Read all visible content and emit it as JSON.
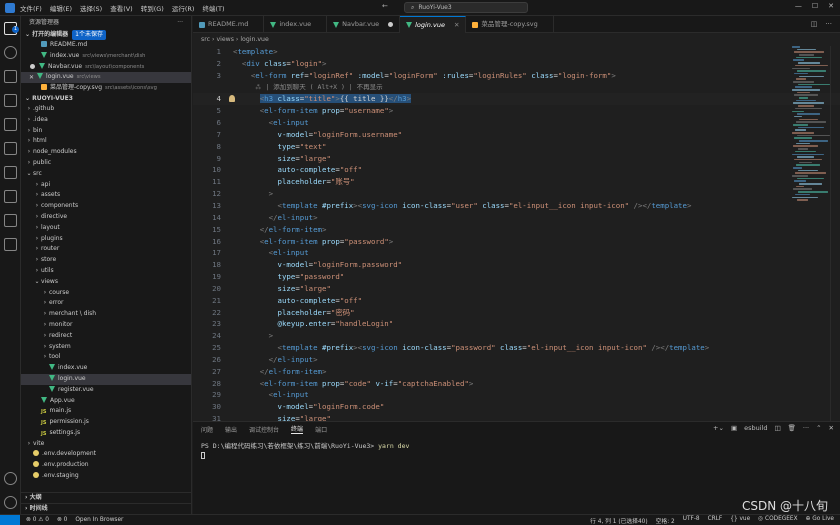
{
  "titlebar": {
    "menu": [
      "文件(F)",
      "编辑(E)",
      "选择(S)",
      "查看(V)",
      "转到(G)",
      "运行(R)",
      "终端(T)"
    ],
    "search": "RuoYi-Vue3",
    "nav_back": "←",
    "nav_forward": "→"
  },
  "sidebar": {
    "title": "资源管理器",
    "open_editors": {
      "label": "打开的编辑器",
      "badge": "1个未保存"
    },
    "open_files": [
      {
        "name": "README.md",
        "path": "",
        "icon": "md"
      },
      {
        "name": "index.vue",
        "path": "src\\views\\merchant\\dish",
        "icon": "vue"
      },
      {
        "name": "Navbar.vue",
        "path": "src\\layout\\components",
        "icon": "vue",
        "modified": true
      },
      {
        "name": "login.vue",
        "path": "src\\views",
        "icon": "vue",
        "active": true
      },
      {
        "name": "菜品管理-copy.svg",
        "path": "src\\assets\\icons\\svg",
        "icon": "svg"
      }
    ],
    "project": "RUOYI-VUE3",
    "tree": [
      {
        "name": ".github",
        "depth": 1,
        "chev": "›"
      },
      {
        "name": ".idea",
        "depth": 1,
        "chev": "›"
      },
      {
        "name": "bin",
        "depth": 1,
        "chev": "›"
      },
      {
        "name": "html",
        "depth": 1,
        "chev": "›"
      },
      {
        "name": "node_modules",
        "depth": 1,
        "chev": "›"
      },
      {
        "name": "public",
        "depth": 1,
        "chev": "›"
      },
      {
        "name": "src",
        "depth": 1,
        "chev": "⌄"
      },
      {
        "name": "api",
        "depth": 2,
        "chev": "›"
      },
      {
        "name": "assets",
        "depth": 2,
        "chev": "›"
      },
      {
        "name": "components",
        "depth": 2,
        "chev": "›"
      },
      {
        "name": "directive",
        "depth": 2,
        "chev": "›"
      },
      {
        "name": "layout",
        "depth": 2,
        "chev": "›"
      },
      {
        "name": "plugins",
        "depth": 2,
        "chev": "›"
      },
      {
        "name": "router",
        "depth": 2,
        "chev": "›"
      },
      {
        "name": "store",
        "depth": 2,
        "chev": "›"
      },
      {
        "name": "utils",
        "depth": 2,
        "chev": "›"
      },
      {
        "name": "views",
        "depth": 2,
        "chev": "⌄"
      },
      {
        "name": "course",
        "depth": 3,
        "chev": "›"
      },
      {
        "name": "error",
        "depth": 3,
        "chev": "›"
      },
      {
        "name": "merchant \\ dish",
        "depth": 3,
        "chev": "›"
      },
      {
        "name": "monitor",
        "depth": 3,
        "chev": "›"
      },
      {
        "name": "redirect",
        "depth": 3,
        "chev": "›"
      },
      {
        "name": "system",
        "depth": 3,
        "chev": "›"
      },
      {
        "name": "tool",
        "depth": 3,
        "chev": "›"
      },
      {
        "name": "index.vue",
        "depth": 3,
        "icon": "vue"
      },
      {
        "name": "login.vue",
        "depth": 3,
        "icon": "vue",
        "selected": true
      },
      {
        "name": "register.vue",
        "depth": 3,
        "icon": "vue"
      },
      {
        "name": "App.vue",
        "depth": 2,
        "icon": "vue"
      },
      {
        "name": "main.js",
        "depth": 2,
        "icon": "js"
      },
      {
        "name": "permission.js",
        "depth": 2,
        "icon": "js"
      },
      {
        "name": "settings.js",
        "depth": 2,
        "icon": "js"
      },
      {
        "name": "vite",
        "depth": 1,
        "chev": "›"
      },
      {
        "name": ".env.development",
        "depth": 1,
        "icon": "env"
      },
      {
        "name": ".env.production",
        "depth": 1,
        "icon": "env"
      },
      {
        "name": ".env.staging",
        "depth": 1,
        "icon": "env"
      }
    ],
    "outline": "大纲",
    "timeline": "时间线"
  },
  "tabs": [
    {
      "label": "README.md",
      "icon": "md"
    },
    {
      "label": "index.vue",
      "icon": "vue"
    },
    {
      "label": "Navbar.vue",
      "icon": "vue",
      "modified": true
    },
    {
      "label": "login.vue",
      "icon": "vue",
      "active": true
    },
    {
      "label": "菜品管理-copy.svg",
      "icon": "svg"
    }
  ],
  "breadcrumb": "src  ›  views  ›  login.vue",
  "editor": {
    "hint_text": "⁂ | 添加到聊天 ( Alt+X ) | 不再显示",
    "current_line": 4,
    "lines": [
      {
        "n": 1,
        "html": "<span class='p'>&lt;</span><span class='t'>template</span><span class='p'>&gt;</span>"
      },
      {
        "n": 2,
        "html": "  <span class='p'>&lt;</span><span class='t'>div</span> <span class='a'>class</span><span class='w'>=</span><span class='s'>\"login\"</span><span class='p'>&gt;</span>"
      },
      {
        "n": 3,
        "html": "    <span class='p'>&lt;</span><span class='t'>el-form</span> <span class='a'>ref</span><span class='w'>=</span><span class='s'>\"loginRef\"</span> <span class='a'>:model</span><span class='w'>=</span><span class='s'>\"loginForm\"</span> <span class='a'>:rules</span><span class='w'>=</span><span class='s'>\"loginRules\"</span> <span class='a'>class</span><span class='w'>=</span><span class='s'>\"login-form\"</span><span class='p'>&gt;</span>"
      },
      {
        "n": 4,
        "html": "      <span class='sel-txt'><span class='p'>&lt;</span><span class='t'>h3</span> <span class='a'>class</span><span class='w'>=</span><span class='s'>\"title\"</span><span class='p'>&gt;</span><span class='w'>{{ title }}</span><span class='p'>&lt;/</span><span class='t'>h3</span><span class='p'>&gt;</span></span>"
      },
      {
        "n": 5,
        "html": "      <span class='p'>&lt;</span><span class='t'>el-form-item</span> <span class='a'>prop</span><span class='w'>=</span><span class='s'>\"username\"</span><span class='p'>&gt;</span>"
      },
      {
        "n": 6,
        "html": "        <span class='p'>&lt;</span><span class='t'>el-input</span>"
      },
      {
        "n": 7,
        "html": "          <span class='a'>v-model</span><span class='w'>=</span><span class='s'>\"loginForm.username\"</span>"
      },
      {
        "n": 8,
        "html": "          <span class='a'>type</span><span class='w'>=</span><span class='s'>\"text\"</span>"
      },
      {
        "n": 9,
        "html": "          <span class='a'>size</span><span class='w'>=</span><span class='s'>\"large\"</span>"
      },
      {
        "n": 10,
        "html": "          <span class='a'>auto-complete</span><span class='w'>=</span><span class='s'>\"off\"</span>"
      },
      {
        "n": 11,
        "html": "          <span class='a'>placeholder</span><span class='w'>=</span><span class='s'>\"账号\"</span>"
      },
      {
        "n": 12,
        "html": "        <span class='p'>&gt;</span>"
      },
      {
        "n": 13,
        "html": "          <span class='p'>&lt;</span><span class='t'>template</span> <span class='a'>#prefix</span><span class='p'>&gt;&lt;</span><span class='t'>svg-icon</span> <span class='a'>icon-class</span><span class='w'>=</span><span class='s'>\"user\"</span> <span class='a'>class</span><span class='w'>=</span><span class='s'>\"el-input__icon input-icon\"</span> <span class='p'>/&gt;&lt;/</span><span class='t'>template</span><span class='p'>&gt;</span>"
      },
      {
        "n": 14,
        "html": "        <span class='p'>&lt;/</span><span class='t'>el-input</span><span class='p'>&gt;</span>"
      },
      {
        "n": 15,
        "html": "      <span class='p'>&lt;/</span><span class='t'>el-form-item</span><span class='p'>&gt;</span>"
      },
      {
        "n": 16,
        "html": "      <span class='p'>&lt;</span><span class='t'>el-form-item</span> <span class='a'>prop</span><span class='w'>=</span><span class='s'>\"password\"</span><span class='p'>&gt;</span>"
      },
      {
        "n": 17,
        "html": "        <span class='p'>&lt;</span><span class='t'>el-input</span>"
      },
      {
        "n": 18,
        "html": "          <span class='a'>v-model</span><span class='w'>=</span><span class='s'>\"loginForm.password\"</span>"
      },
      {
        "n": 19,
        "html": "          <span class='a'>type</span><span class='w'>=</span><span class='s'>\"password\"</span>"
      },
      {
        "n": 20,
        "html": "          <span class='a'>size</span><span class='w'>=</span><span class='s'>\"large\"</span>"
      },
      {
        "n": 21,
        "html": "          <span class='a'>auto-complete</span><span class='w'>=</span><span class='s'>\"off\"</span>"
      },
      {
        "n": 22,
        "html": "          <span class='a'>placeholder</span><span class='w'>=</span><span class='s'>\"密码\"</span>"
      },
      {
        "n": 23,
        "html": "          <span class='a'>@keyup.enter</span><span class='w'>=</span><span class='s'>\"handleLogin\"</span>"
      },
      {
        "n": 24,
        "html": "        <span class='p'>&gt;</span>"
      },
      {
        "n": 25,
        "html": "          <span class='p'>&lt;</span><span class='t'>template</span> <span class='a'>#prefix</span><span class='p'>&gt;&lt;</span><span class='t'>svg-icon</span> <span class='a'>icon-class</span><span class='w'>=</span><span class='s'>\"password\"</span> <span class='a'>class</span><span class='w'>=</span><span class='s'>\"el-input__icon input-icon\"</span> <span class='p'>/&gt;&lt;/</span><span class='t'>template</span><span class='p'>&gt;</span>"
      },
      {
        "n": 26,
        "html": "        <span class='p'>&lt;/</span><span class='t'>el-input</span><span class='p'>&gt;</span>"
      },
      {
        "n": 27,
        "html": "      <span class='p'>&lt;/</span><span class='t'>el-form-item</span><span class='p'>&gt;</span>"
      },
      {
        "n": 28,
        "html": "      <span class='p'>&lt;</span><span class='t'>el-form-item</span> <span class='a'>prop</span><span class='w'>=</span><span class='s'>\"code\"</span> <span class='a'>v-if</span><span class='w'>=</span><span class='s'>\"captchaEnabled\"</span><span class='p'>&gt;</span>"
      },
      {
        "n": 29,
        "html": "        <span class='p'>&lt;</span><span class='t'>el-input</span>"
      },
      {
        "n": 30,
        "html": "          <span class='a'>v-model</span><span class='w'>=</span><span class='s'>\"loginForm.code\"</span>"
      },
      {
        "n": 31,
        "html": "          <span class='a'>size</span><span class='w'>=</span><span class='s'>\"large\"</span>"
      }
    ]
  },
  "panel": {
    "tabs": [
      "问题",
      "输出",
      "调试控制台",
      "终端",
      "端口"
    ],
    "active_tab": "终端",
    "terminal_name": "esbuild",
    "prompt": "PS D:\\编程代码练习\\若依框架\\练习\\前端\\RuoYi-Vue3> ",
    "command": "yarn dev"
  },
  "status": {
    "left": [
      "⊗ 0 ⚠ 0",
      "⊗ 0",
      "Open In Browser"
    ],
    "right": [
      "行 4, 列 1 (已选择40)",
      "空格: 2",
      "UTF-8",
      "CRLF",
      "{} vue",
      "◎ CODEGEEX",
      "⊕ Go Live"
    ]
  },
  "watermark": "CSDN @十八旬"
}
